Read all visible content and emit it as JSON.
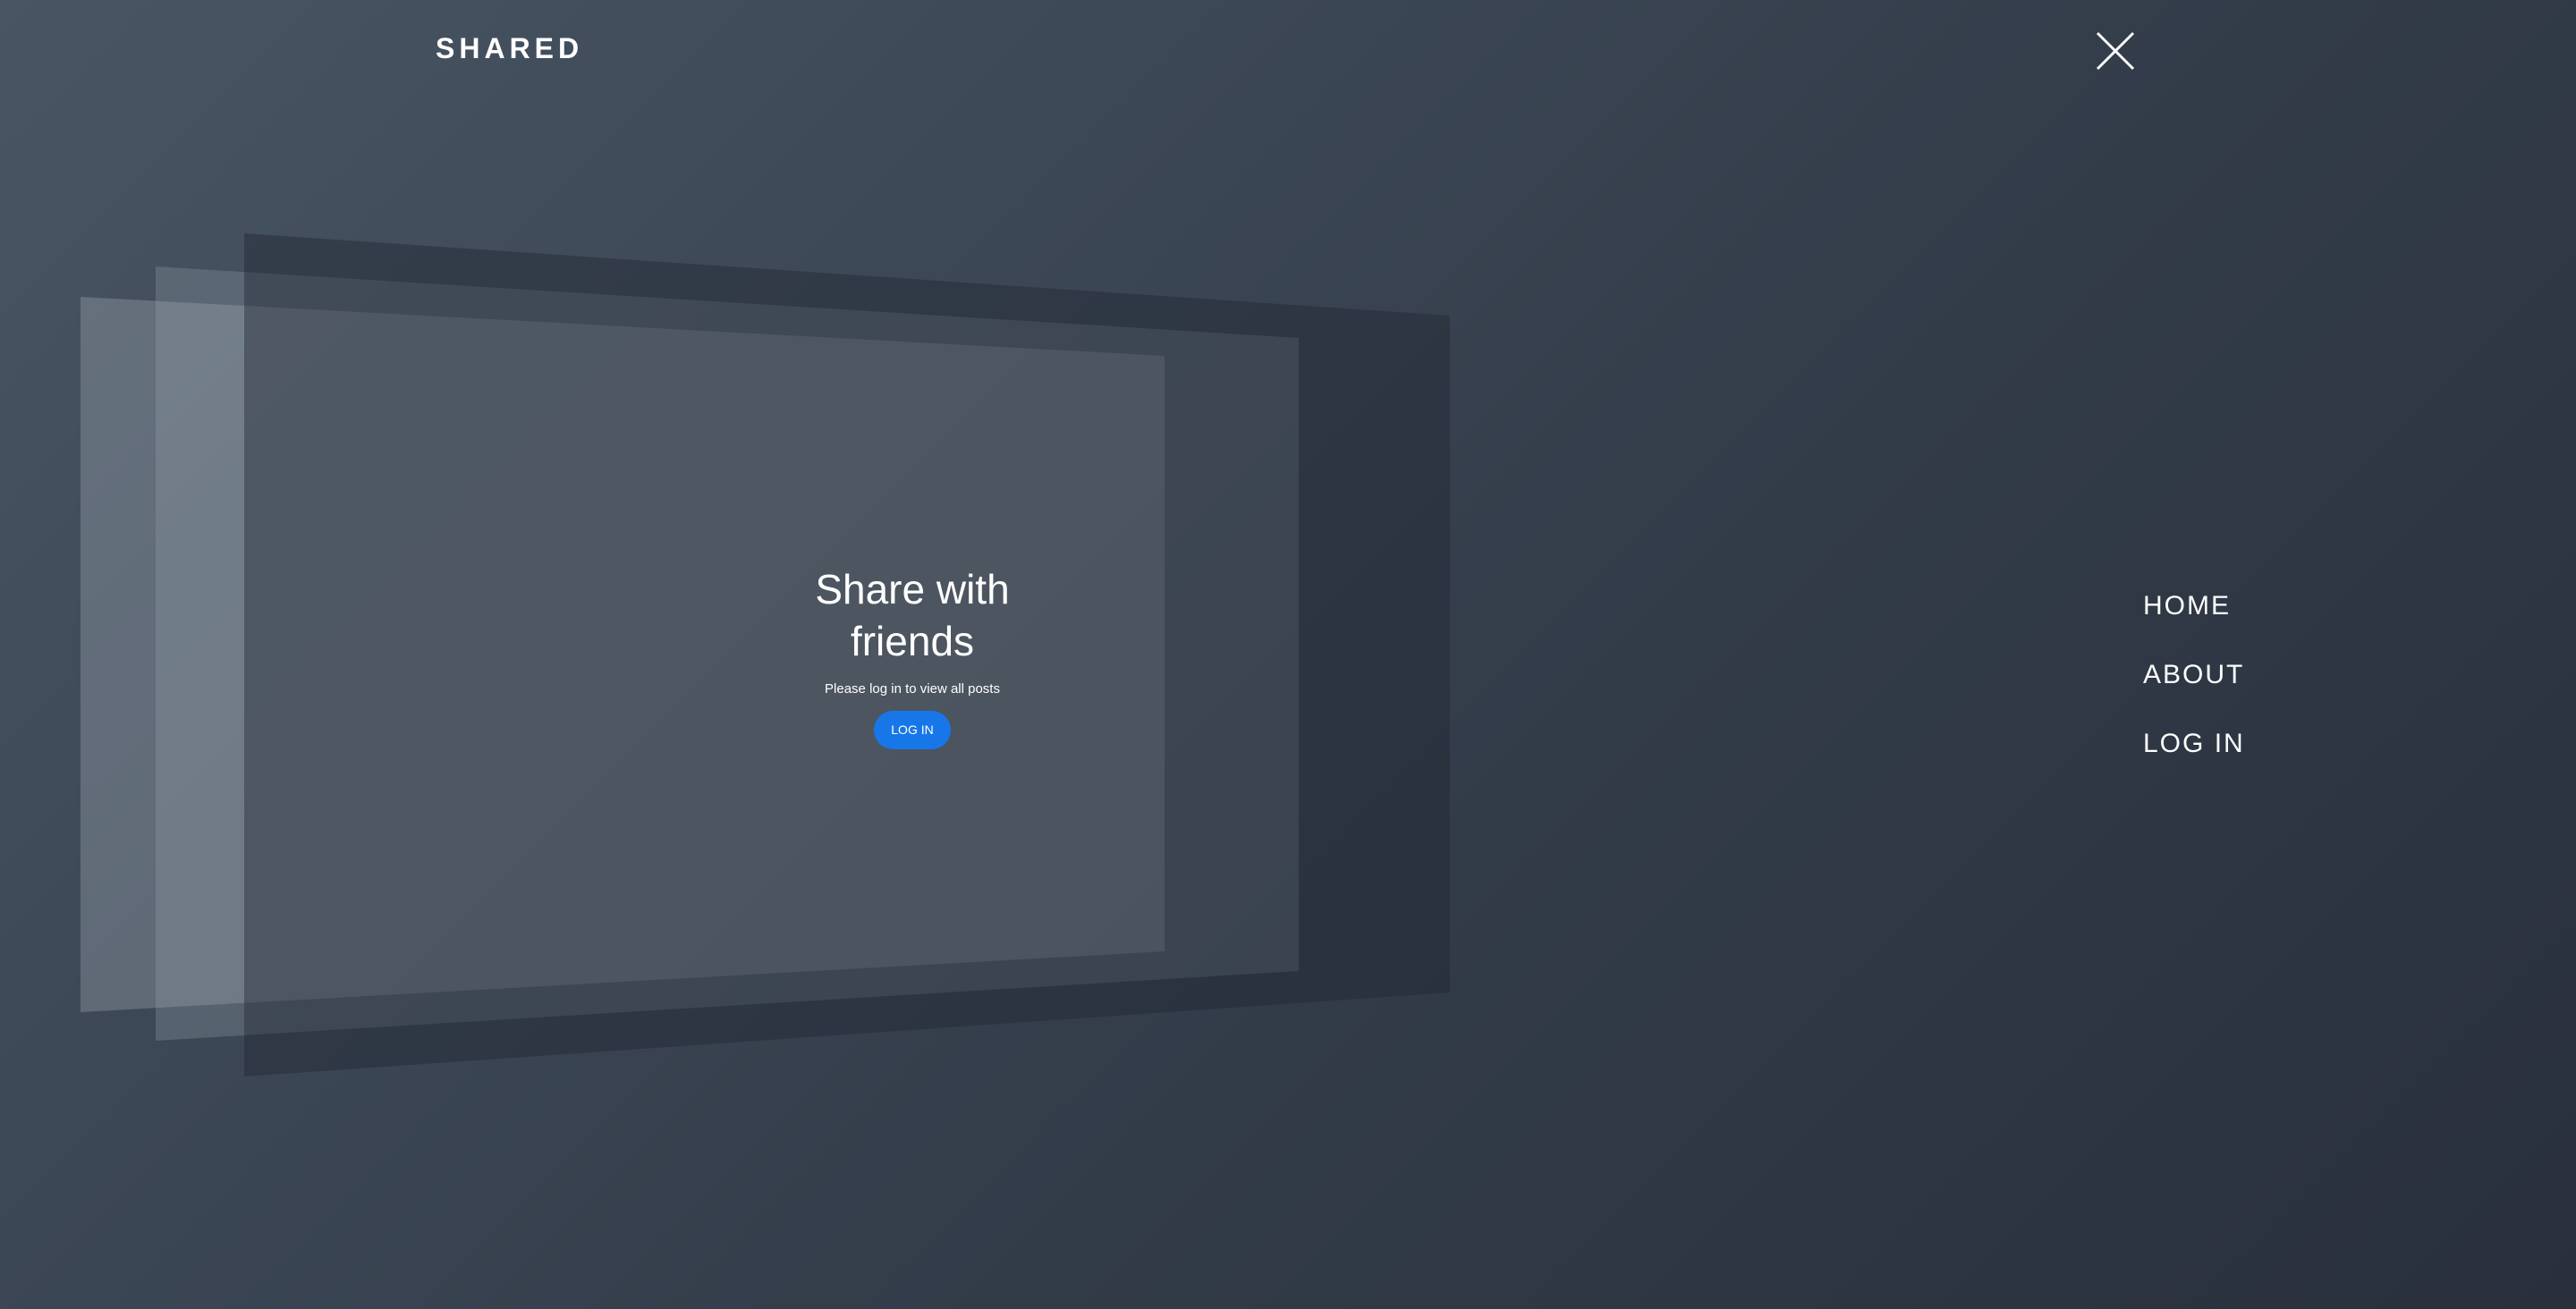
{
  "header": {
    "logo": "SHARED",
    "close_icon": "close-icon"
  },
  "hero": {
    "title_line1": "Share with",
    "title_line2": "friends",
    "subtitle": "Please log in to view all posts",
    "button_label": "LOG IN",
    "button_color": "#1877e8"
  },
  "nav": {
    "items": [
      {
        "label": "HOME"
      },
      {
        "label": "ABOUT"
      },
      {
        "label": "LOG IN"
      }
    ]
  },
  "colors": {
    "background_light": "#485563",
    "background_dark": "#29303c",
    "text": "#ffffff"
  }
}
